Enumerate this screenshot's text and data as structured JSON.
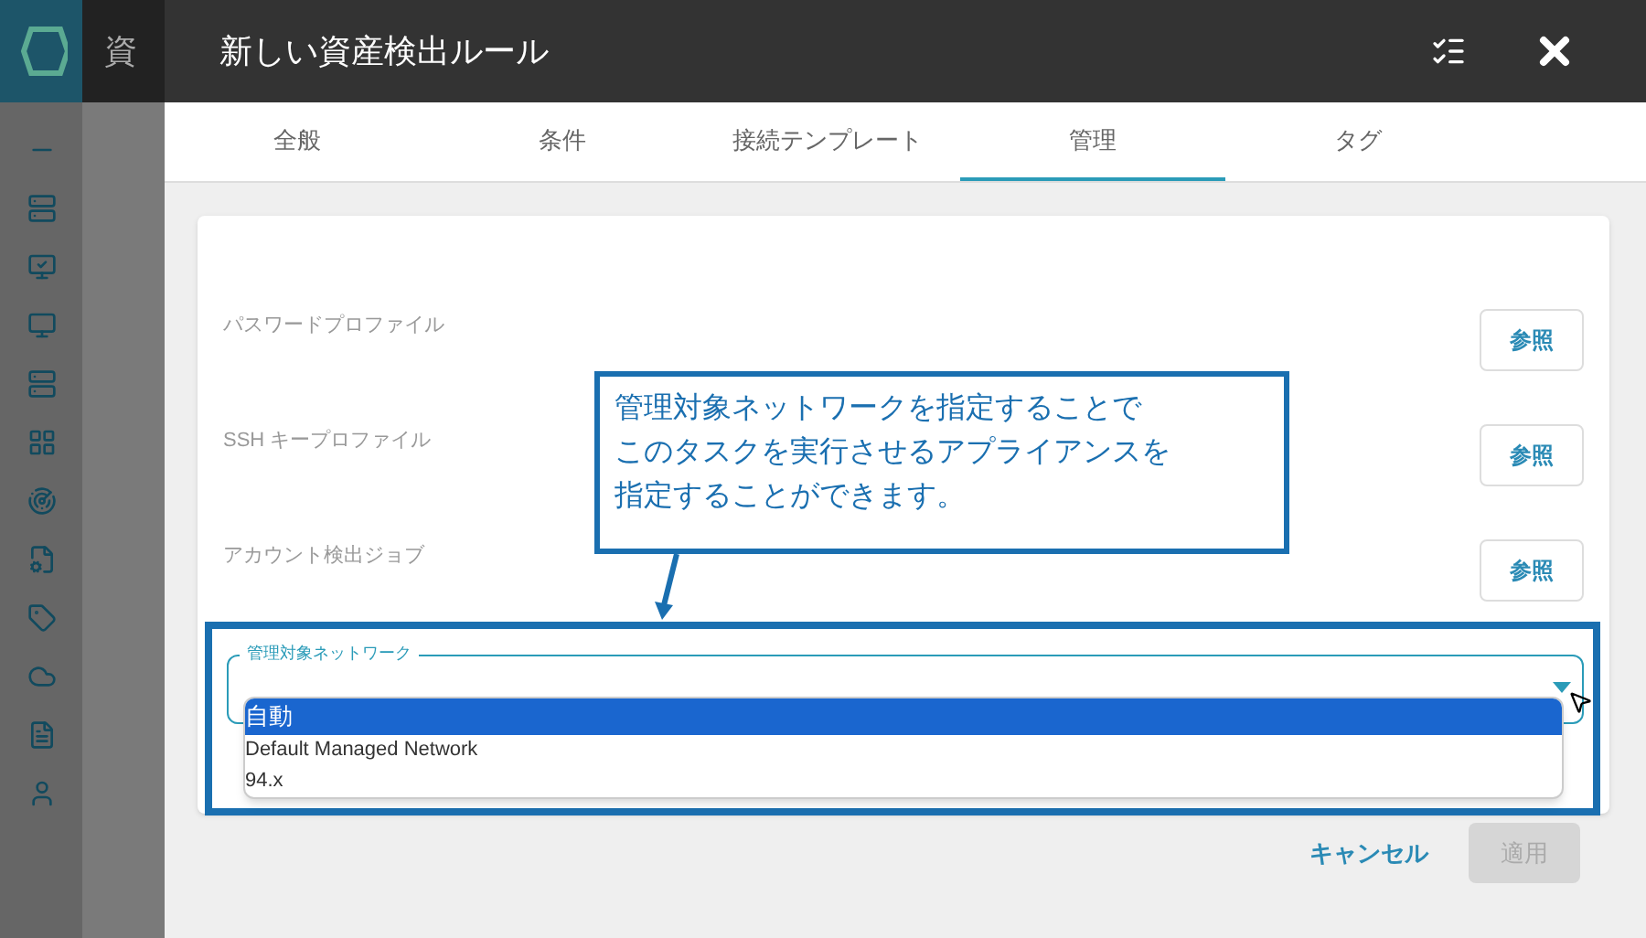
{
  "background_app": {
    "title": "資"
  },
  "dialog": {
    "title": "新しい資産検出ルール"
  },
  "tabs": [
    {
      "label": "全般",
      "selected": false
    },
    {
      "label": "条件",
      "selected": false
    },
    {
      "label": "接続テンプレート",
      "selected": false
    },
    {
      "label": "管理",
      "selected": true
    },
    {
      "label": "タグ",
      "selected": false
    }
  ],
  "fields": [
    {
      "label": "パスワードプロファイル",
      "button": "参照"
    },
    {
      "label": "SSH キープロファイル",
      "button": "参照"
    },
    {
      "label": "アカウント検出ジョブ",
      "button": "参照"
    }
  ],
  "callout": {
    "lines": [
      "管理対象ネットワークを指定することで",
      "このタスクを実行させるアプライアンスを",
      "指定することができます。"
    ]
  },
  "network_select": {
    "label": "管理対象ネットワーク",
    "expanded": true,
    "options": [
      {
        "label": "自動",
        "selected": true
      },
      {
        "label": "Default Managed Network",
        "selected": false
      },
      {
        "label": "94.x",
        "selected": false
      }
    ]
  },
  "footer": {
    "cancel": "キャンセル",
    "apply": {
      "label": "適用",
      "disabled": true
    }
  }
}
